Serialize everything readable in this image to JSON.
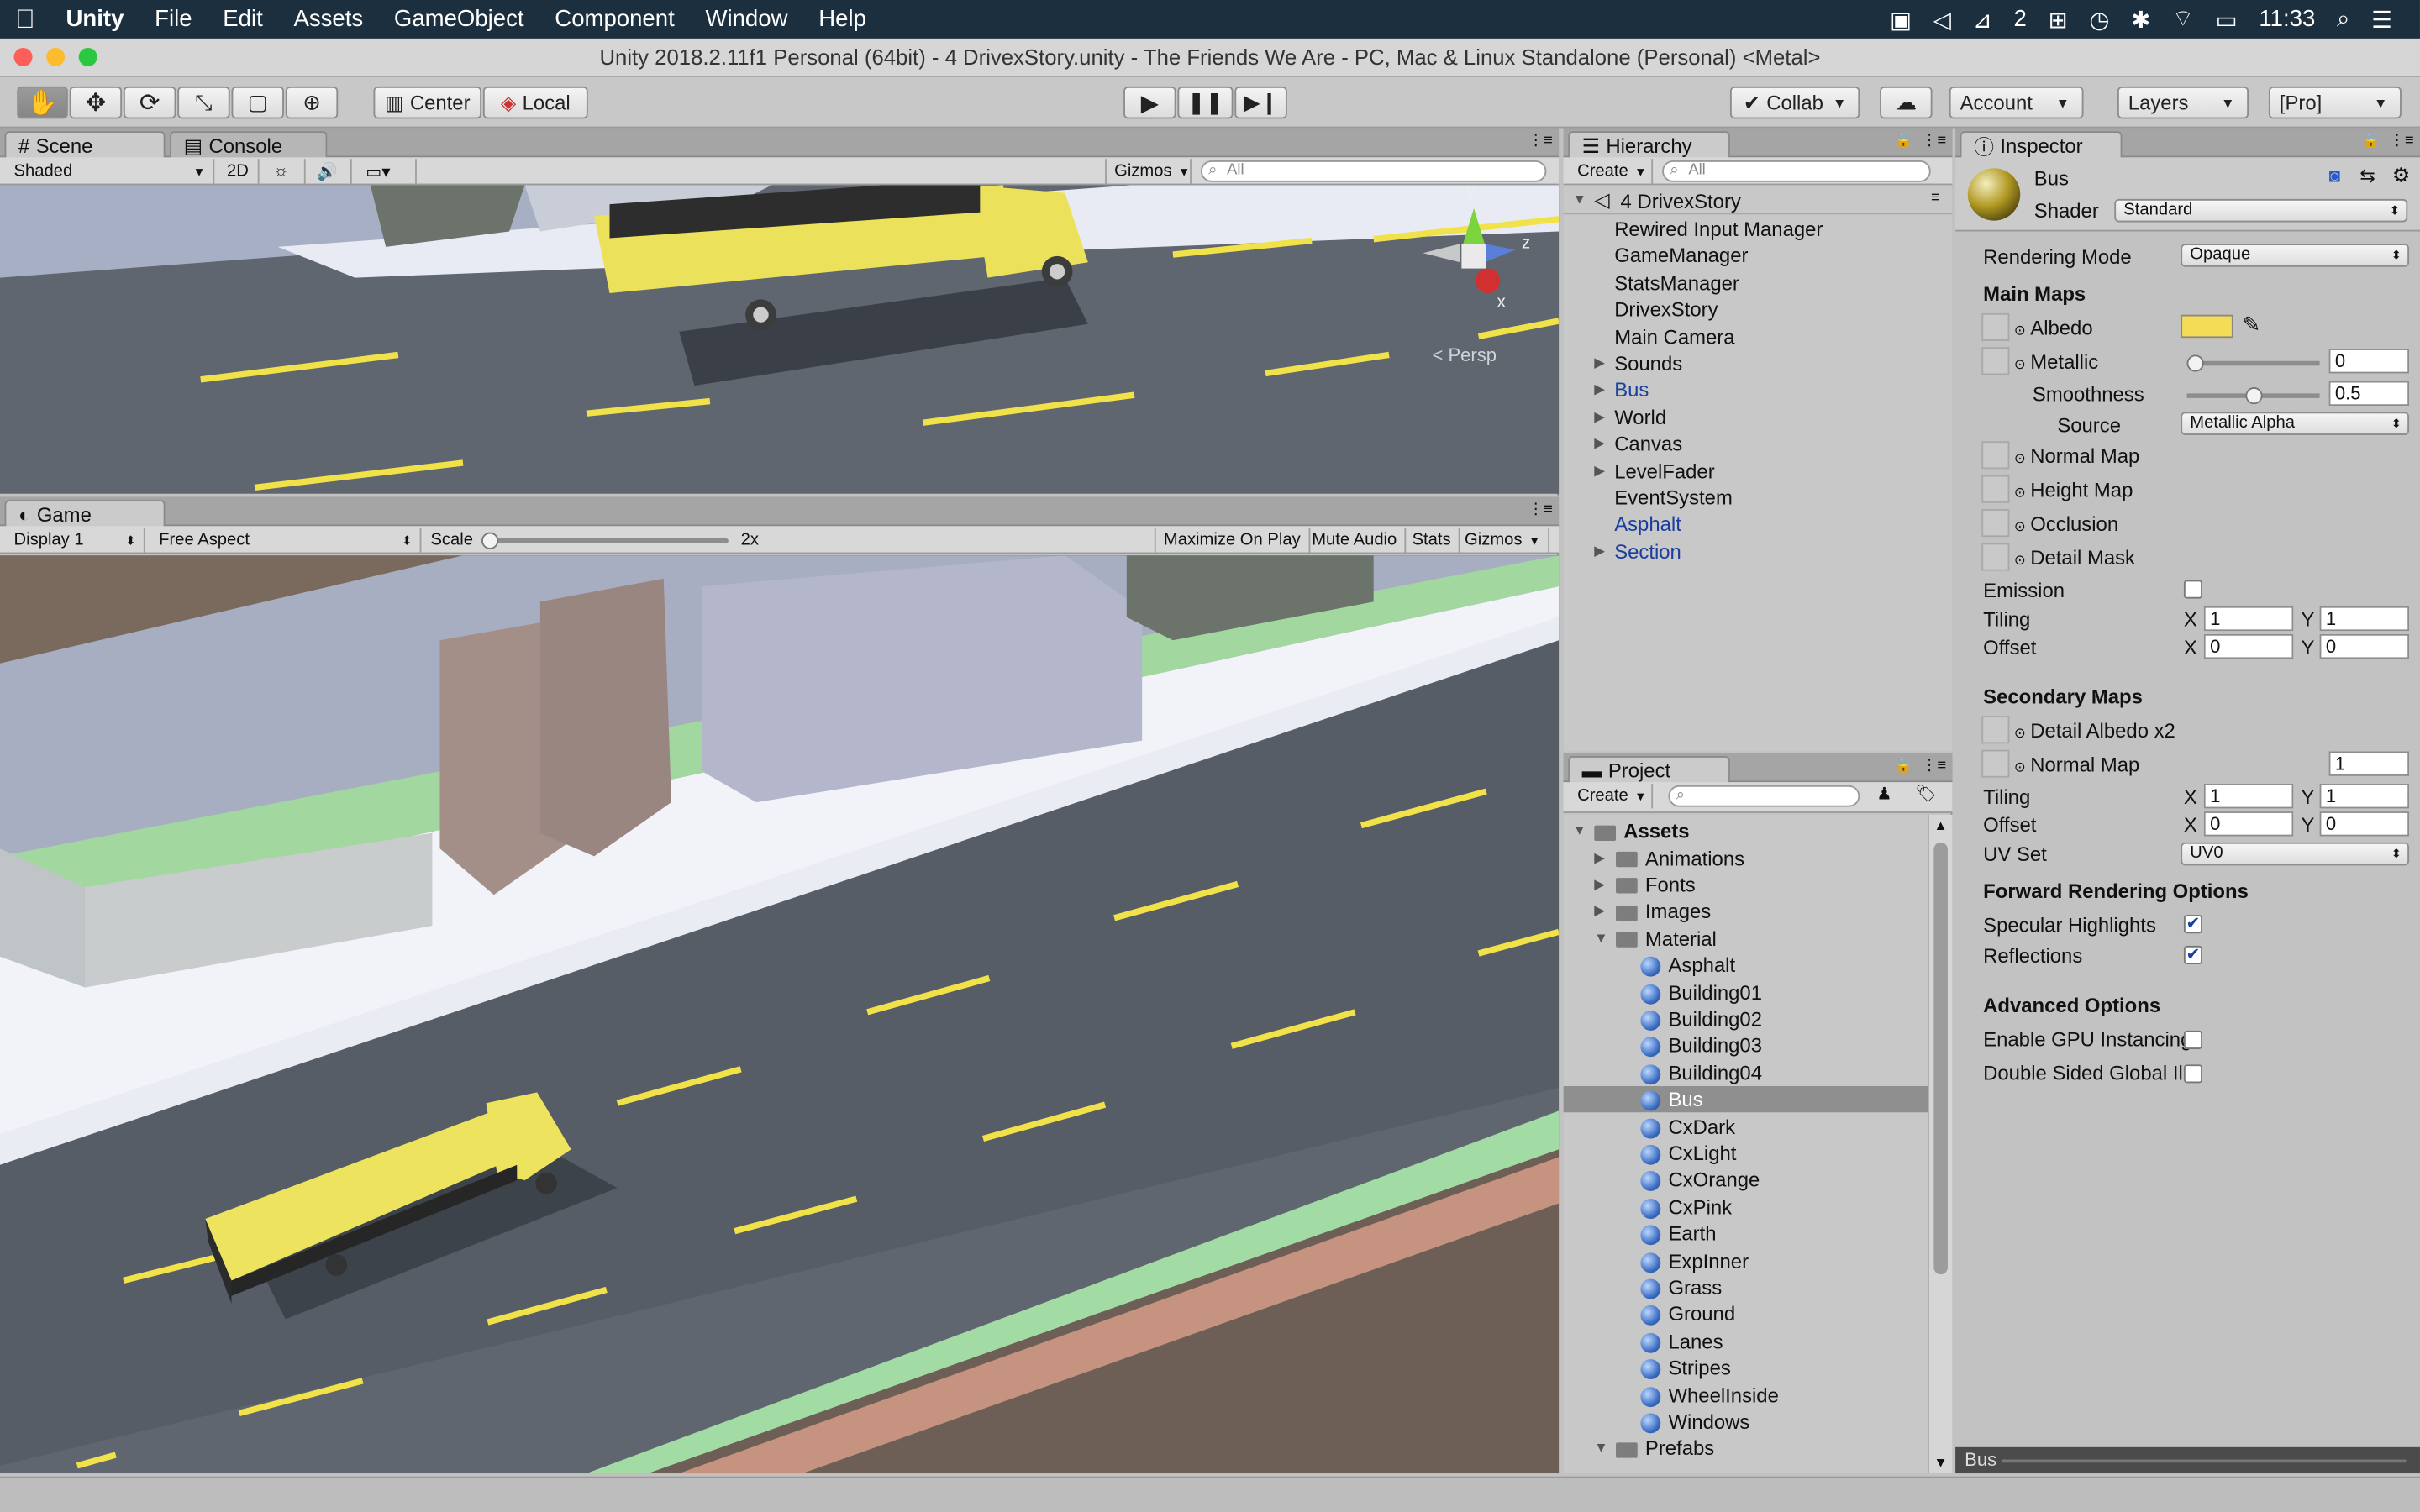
{
  "menubar": {
    "apple": "",
    "app": "Unity",
    "items": [
      "File",
      "Edit",
      "Assets",
      "GameObject",
      "Component",
      "Window",
      "Help"
    ],
    "status_count": "2",
    "clock": "11:33"
  },
  "window": {
    "title": "Unity 2018.2.11f1 Personal (64bit) - 4 DrivexStory.unity - The Friends We Are - PC, Mac & Linux Standalone (Personal) <Metal>"
  },
  "toolbar": {
    "center": "Center",
    "local": "Local",
    "collab": "Collab",
    "account": "Account",
    "layers": "Layers",
    "layout": "[Pro]"
  },
  "scene": {
    "tab": "Scene",
    "console_tab": "Console",
    "shading": "Shaded",
    "mode_2d": "2D",
    "gizmos": "Gizmos",
    "search": "All",
    "persp": "< Persp",
    "axis_y": "y",
    "axis_z": "z",
    "axis_x": "x"
  },
  "game": {
    "tab": "Game",
    "display": "Display 1",
    "aspect": "Free Aspect",
    "scale_label": "Scale",
    "scale_value": "2x",
    "scale_fraction": 0.0,
    "maximize": "Maximize On Play",
    "mute": "Mute Audio",
    "stats": "Stats",
    "gizmos": "Gizmos"
  },
  "hierarchy": {
    "tab": "Hierarchy",
    "create": "Create",
    "search": "All",
    "scene_name": "4 DrivexStory",
    "items": [
      {
        "label": "Rewired Input Manager",
        "expand": false,
        "blue": false
      },
      {
        "label": "GameManager",
        "expand": false,
        "blue": false
      },
      {
        "label": "StatsManager",
        "expand": false,
        "blue": false
      },
      {
        "label": "DrivexStory",
        "expand": false,
        "blue": false
      },
      {
        "label": "Main Camera",
        "expand": false,
        "blue": false
      },
      {
        "label": "Sounds",
        "expand": true,
        "blue": false
      },
      {
        "label": "Bus",
        "expand": true,
        "blue": true
      },
      {
        "label": "World",
        "expand": true,
        "blue": false
      },
      {
        "label": "Canvas",
        "expand": true,
        "blue": false
      },
      {
        "label": "LevelFader",
        "expand": true,
        "blue": false
      },
      {
        "label": "EventSystem",
        "expand": false,
        "blue": false
      },
      {
        "label": "Asphalt",
        "expand": false,
        "blue": true
      },
      {
        "label": "Section",
        "expand": true,
        "blue": true
      }
    ]
  },
  "project": {
    "tab": "Project",
    "create": "Create",
    "root": "Assets",
    "folders": [
      "Animations",
      "Fonts",
      "Images"
    ],
    "material_folder": "Material",
    "materials": [
      "Asphalt",
      "Building01",
      "Building02",
      "Building03",
      "Building04",
      "Bus",
      "CxDark",
      "CxLight",
      "CxOrange",
      "CxPink",
      "Earth",
      "ExpInner",
      "Grass",
      "Ground",
      "Lanes",
      "Stripes",
      "WheelInside",
      "Windows"
    ],
    "selected": "Bus",
    "prefabs": "Prefabs"
  },
  "inspector": {
    "tab": "Inspector",
    "name": "Bus",
    "shader_label": "Shader",
    "shader": "Standard",
    "rendering_mode_label": "Rendering Mode",
    "rendering_mode": "Opaque",
    "main_maps": "Main Maps",
    "albedo": "Albedo",
    "albedo_color": "#f4dc56",
    "metallic": "Metallic",
    "metallic_value": "0",
    "metallic_fraction": 0.0,
    "smoothness": "Smoothness",
    "smoothness_value": "0.5",
    "smoothness_fraction": 0.5,
    "source": "Source",
    "source_value": "Metallic Alpha",
    "normal_map": "Normal Map",
    "height_map": "Height Map",
    "occlusion": "Occlusion",
    "detail_mask": "Detail Mask",
    "emission": "Emission",
    "tiling": "Tiling",
    "offset": "Offset",
    "x": "X",
    "y": "Y",
    "main_tiling_x": "1",
    "main_tiling_y": "1",
    "main_offset_x": "0",
    "main_offset_y": "0",
    "secondary_maps": "Secondary Maps",
    "detail_albedo": "Detail Albedo x2",
    "sec_normal_map": "Normal Map",
    "sec_normal_value": "1",
    "sec_tiling_x": "1",
    "sec_tiling_y": "1",
    "sec_offset_x": "0",
    "sec_offset_y": "0",
    "uv_set": "UV Set",
    "uv_value": "UV0",
    "forward": "Forward Rendering Options",
    "specular": "Specular Highlights",
    "reflections": "Reflections",
    "advanced": "Advanced Options",
    "gpu_instancing": "Enable GPU Instancing",
    "double_sided": "Double Sided Global Il",
    "preview": "Bus"
  }
}
